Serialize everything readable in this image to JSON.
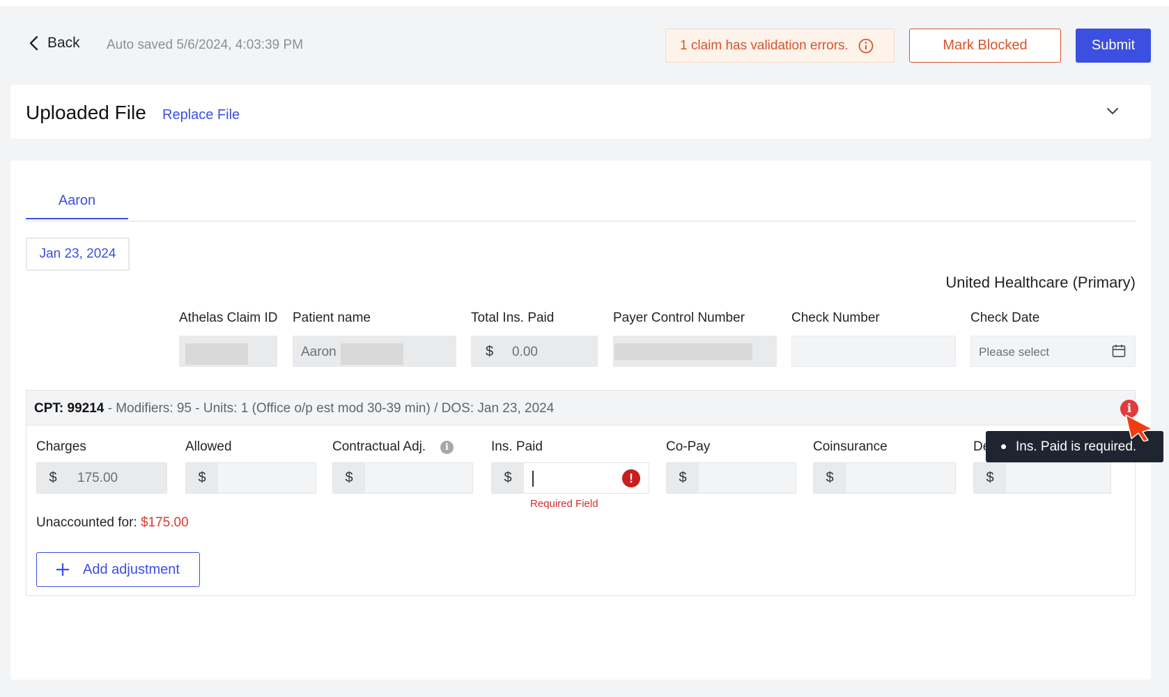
{
  "header": {
    "back_label": "Back",
    "autosave_text": "Auto saved 5/6/2024, 4:03:39 PM",
    "validation_text": "1 claim has validation errors.",
    "mark_blocked_label": "Mark Blocked",
    "submit_label": "Submit"
  },
  "file_card": {
    "title": "Uploaded File",
    "replace_label": "Replace File"
  },
  "tabs": [
    {
      "label": "Aaron"
    }
  ],
  "date_chip": "Jan 23, 2024",
  "payer": "United Healthcare (Primary)",
  "claim_fields": {
    "athelas_claim_id_label": "Athelas Claim ID",
    "patient_name_label": "Patient name",
    "patient_name_value": "Aaron",
    "total_ins_paid_label": "Total Ins. Paid",
    "total_ins_paid_value": "0.00",
    "currency_symbol": "$",
    "payer_control_label": "Payer Control Number",
    "check_number_label": "Check Number",
    "check_date_label": "Check Date",
    "check_date_placeholder": "Please select"
  },
  "cpt": {
    "code_label": "CPT: 99214",
    "details": " - Modifiers: 95 - Units: 1 (Office o/p est mod 30-39 min) / DOS: Jan 23, 2024",
    "error_icon_glyph": "i",
    "fields": {
      "charges_label": "Charges",
      "charges_value": "175.00",
      "allowed_label": "Allowed",
      "contractual_label": "Contractual Adj.",
      "ins_paid_label": "Ins. Paid",
      "copay_label": "Co-Pay",
      "coinsurance_label": "Coinsurance",
      "deductible_label": "De"
    },
    "required_text": "Required Field",
    "unaccounted_label": "Unaccounted for: ",
    "unaccounted_amount": "$175.00",
    "add_adjustment_label": "Add adjustment"
  },
  "tooltip": {
    "text": "Ins. Paid is required."
  },
  "colors": {
    "accent": "#3b4fe0",
    "error": "#d9532c",
    "tooltip_bg": "#1f2530"
  }
}
